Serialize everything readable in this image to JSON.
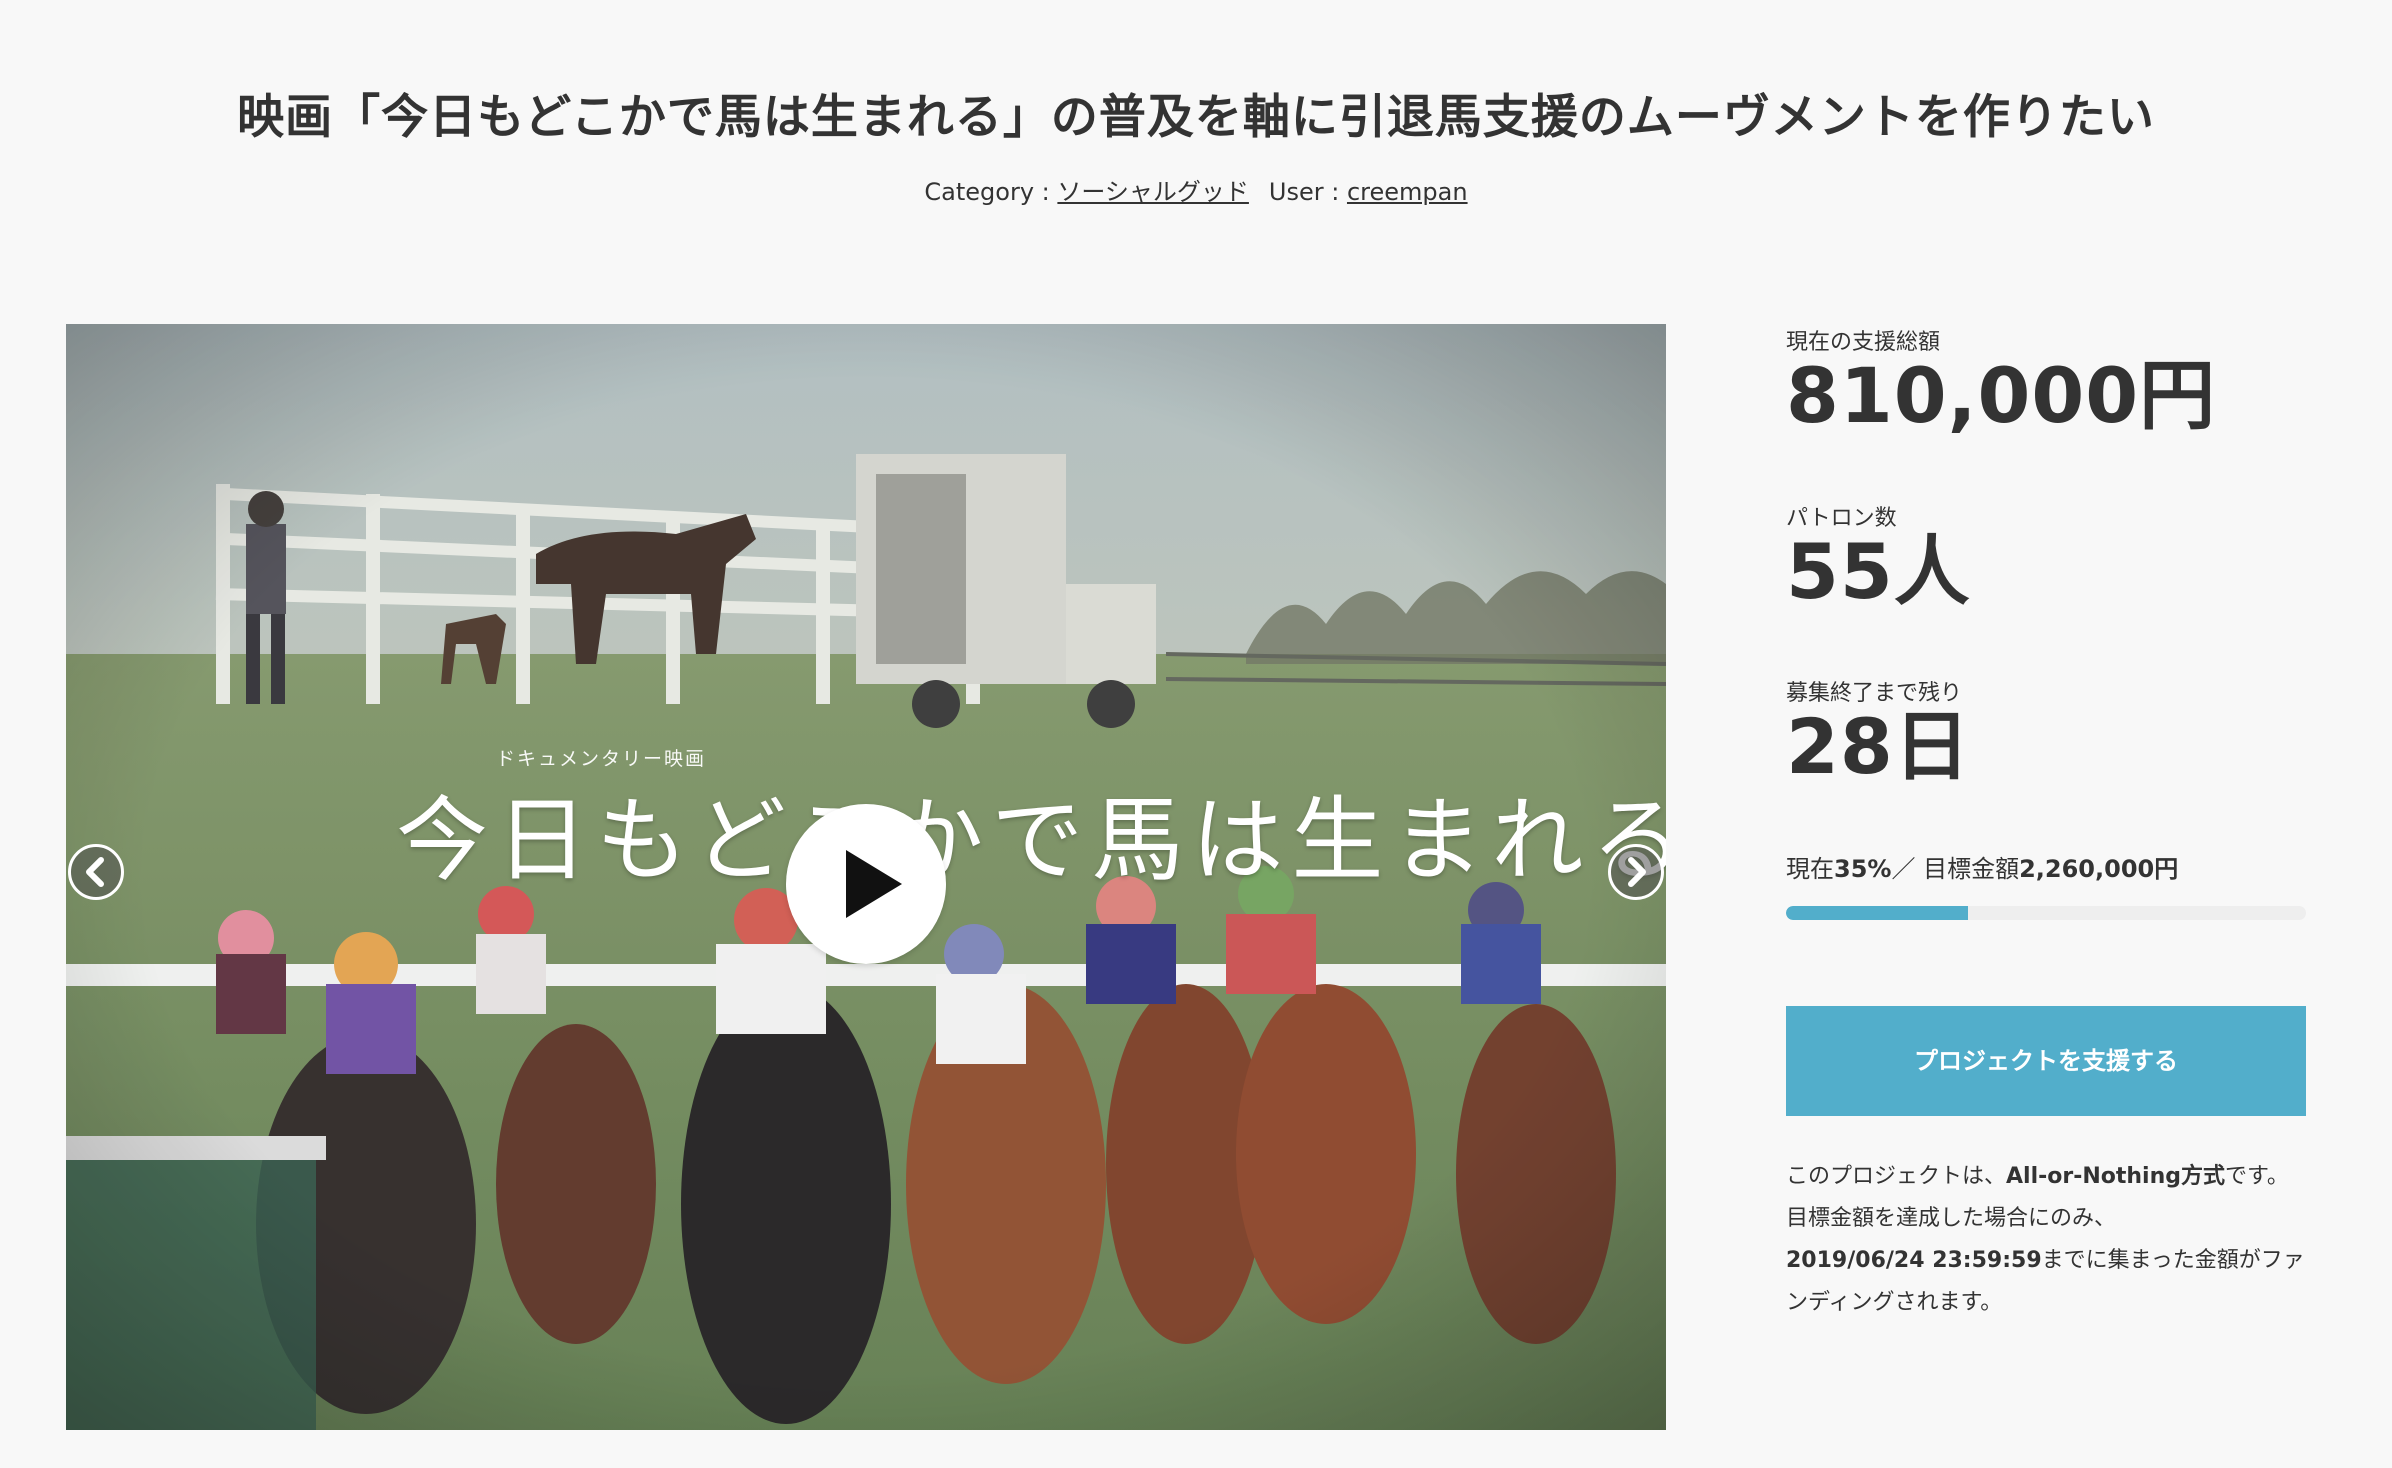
{
  "project": {
    "title": "映画「今日もどこかで馬は生まれる」の普及を軸に引退馬支援のムーヴメントを作りたい",
    "category_label": "Category : ",
    "category_value": "ソーシャルグッド",
    "user_label": "User : ",
    "user_value": "creempan"
  },
  "video": {
    "doc_label": "ドキュメンタリー映画",
    "film_title": "今日もどこかで馬は生まれる"
  },
  "stats": {
    "total_label": "現在の支援総額",
    "total_value": "810,000円",
    "patrons_label": "パトロン数",
    "patrons_value": "55人",
    "remaining_label": "募集終了まで残り",
    "remaining_value": "28日"
  },
  "progress": {
    "prefix": "現在",
    "percent_text": "35%",
    "separator": "／ 目標金額",
    "goal_text": "2,260,000円",
    "fraction": 0.35
  },
  "support_button_label": "プロジェクトを支援する",
  "note": {
    "line1_a": "このプロジェクトは、",
    "line1_b": "All-or-Nothing方式",
    "line1_c": "です。",
    "line2": "目標金額を達成した場合にのみ、",
    "line3_a": "2019/06/24 23:59:59",
    "line3_b": "までに集まった金額がファンディングされます。"
  },
  "colors": {
    "accent": "#52aecb",
    "text": "#333333",
    "background": "#f8f8f8",
    "track": "#eeeeee"
  },
  "icons": {
    "play": "play-icon",
    "prev": "chevron-left-icon",
    "next": "chevron-right-icon"
  }
}
